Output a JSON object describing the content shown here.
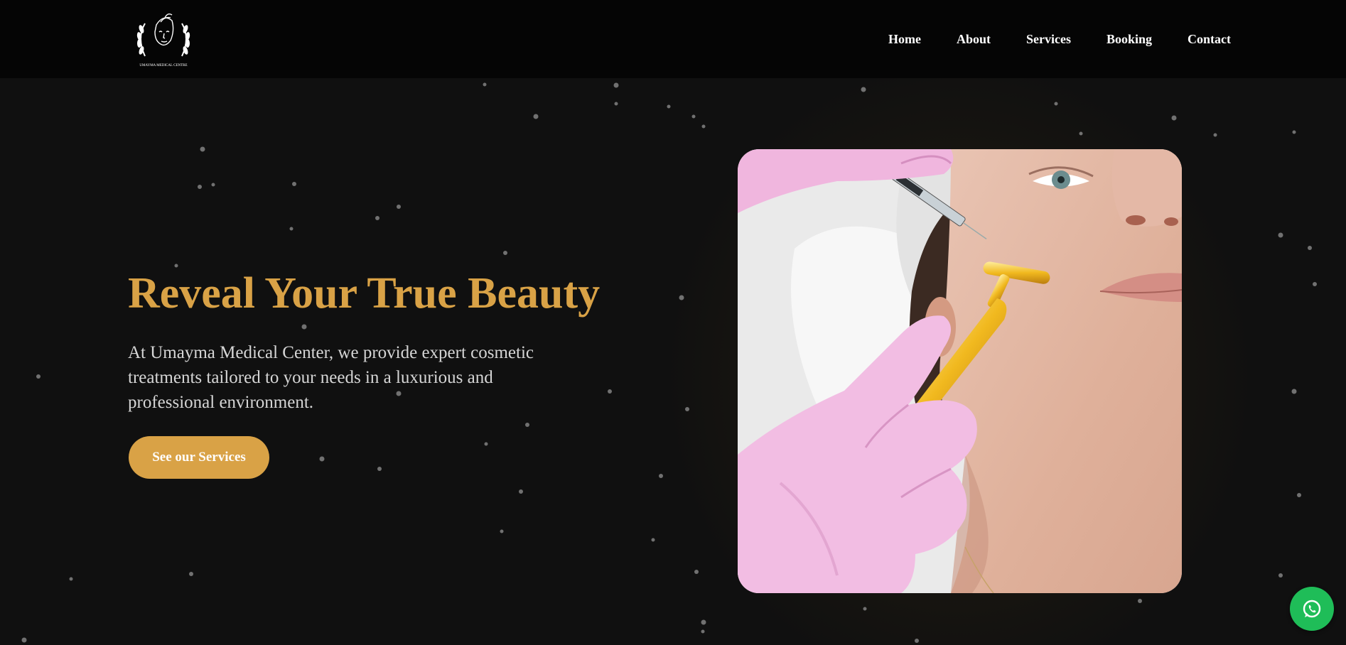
{
  "brand": {
    "logo_caption": "UMAYMA MEDICAL CENTRE"
  },
  "nav": {
    "items": [
      {
        "label": "Home"
      },
      {
        "label": "About"
      },
      {
        "label": "Services"
      },
      {
        "label": "Booking"
      },
      {
        "label": "Contact"
      }
    ]
  },
  "hero": {
    "title": "Reveal Your True Beauty",
    "description": "At Umayma Medical Center, we provide expert cosmetic treatments tailored to your needs in a luxurious and professional environment.",
    "cta_label": "See our Services"
  },
  "floating": {
    "whatsapp_icon": "whatsapp-icon"
  },
  "colors": {
    "accent": "#d9a246",
    "navbar_bg": "#050505",
    "page_bg": "#101010",
    "whatsapp": "#1fbd58"
  }
}
